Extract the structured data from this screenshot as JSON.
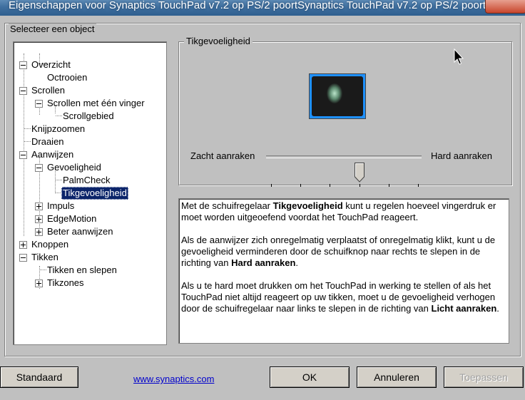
{
  "window": {
    "title": "Eigenschappen voor Synaptics TouchPad v7.2 op PS/2 poortSynaptics TouchPad v7.2 op PS/2 poort"
  },
  "object_group": {
    "label": "Selecteer een object"
  },
  "tree": {
    "items": [
      {
        "label": "Overzicht",
        "expanded": true
      },
      {
        "label": "Octrooien"
      },
      {
        "label": "Scrollen",
        "expanded": true
      },
      {
        "label": "Scrollen met één vinger",
        "expanded": true
      },
      {
        "label": "Scrollgebied"
      },
      {
        "label": "Knijpzoomen"
      },
      {
        "label": "Draaien"
      },
      {
        "label": "Aanwijzen",
        "expanded": true
      },
      {
        "label": "Gevoeligheid",
        "expanded": true
      },
      {
        "label": "PalmCheck"
      },
      {
        "label": "Tikgevoeligheid",
        "selected": true
      },
      {
        "label": "Impuls",
        "expanded": false
      },
      {
        "label": "EdgeMotion",
        "expanded": false
      },
      {
        "label": "Beter aanwijzen",
        "expanded": false
      },
      {
        "label": "Knoppen",
        "expanded": false
      },
      {
        "label": "Tikken",
        "expanded": true
      },
      {
        "label": "Tikken en slepen"
      },
      {
        "label": "Tikzones",
        "expanded": false
      }
    ]
  },
  "settings": {
    "group_title": "Tikgevoeligheid",
    "slider": {
      "left_label": "Zacht aanraken",
      "right_label": "Hard aanraken",
      "tick_count": 6,
      "value_fraction": 0.6
    }
  },
  "description": {
    "p1_a": "Met de schuifregelaar ",
    "p1_b": "Tikgevoeligheid",
    "p1_c": " kunt u regelen hoeveel vingerdruk er moet worden uitgeoefend voordat het TouchPad reageert.",
    "p2_a": "Als de aanwijzer zich onregelmatig verplaatst of onregelmatig klikt, kunt u de gevoeligheid verminderen door de schuifknop naar rechts te slepen in de richting van ",
    "p2_b": "Hard aanraken",
    "p2_c": ".",
    "p3_a": "Als u te hard moet drukken om het TouchPad in werking te stellen of als het TouchPad niet altijd reageert op uw tikken, moet u de gevoeligheid verhogen door de schuifregelaar naar links te slepen in de richting van ",
    "p3_b": "Licht aanraken",
    "p3_c": "."
  },
  "footer": {
    "default_button": "Standaard",
    "link": "www.synaptics.com",
    "ok_button": "OK",
    "cancel_button": "Annuleren",
    "apply_button": "Toepassen"
  }
}
